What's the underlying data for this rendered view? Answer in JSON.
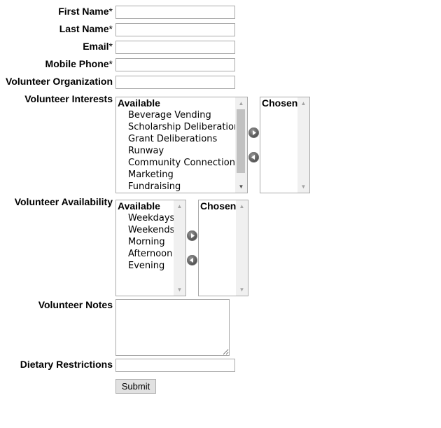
{
  "form": {
    "fields": {
      "first_name": {
        "label": "First Name",
        "required_mark": "*",
        "value": ""
      },
      "last_name": {
        "label": "Last Name",
        "required_mark": "*",
        "value": ""
      },
      "email": {
        "label": "Email",
        "required_mark": "*",
        "value": ""
      },
      "mobile_phone": {
        "label": "Mobile Phone",
        "required_mark": "*",
        "value": ""
      },
      "volunteer_organization": {
        "label": "Volunteer Organization",
        "value": ""
      },
      "volunteer_notes": {
        "label": "Volunteer Notes",
        "value": ""
      },
      "dietary_restrictions": {
        "label": "Dietary Restrictions",
        "value": ""
      }
    },
    "interests": {
      "label": "Volunteer Interests",
      "available_header": "Available",
      "chosen_header": "Chosen",
      "available": [
        "Beverage Vending",
        "Scholarship Deliberations",
        "Grant Deliberations",
        "Runway",
        "Community Connections",
        "Marketing",
        "Fundraising"
      ]
    },
    "availability": {
      "label": "Volunteer Availability",
      "available_header": "Available",
      "chosen_header": "Chosen",
      "available": [
        "Weekdays",
        "Weekends",
        "Morning",
        "Afternoon",
        "Evening"
      ]
    },
    "submit_label": "Submit"
  },
  "icons": {
    "move_right": "arrow-right-circle-icon",
    "move_left": "arrow-left-circle-icon"
  }
}
